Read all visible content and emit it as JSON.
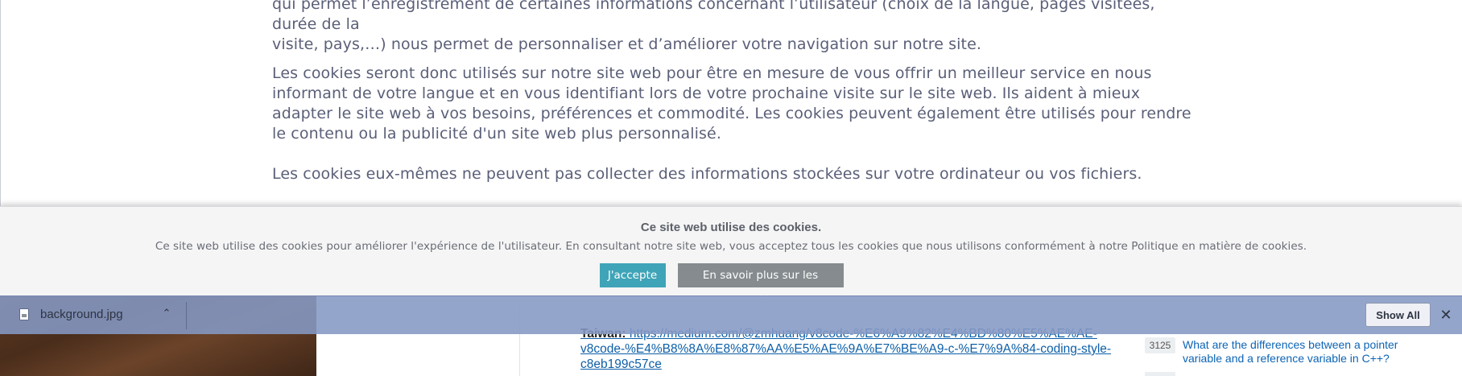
{
  "article": {
    "para1_line1": "qui permet l’enregistrement de certaines informations concernant l’utilisateur (choix de la langue, pages visitées, durée de la",
    "para1_line2": "visite, pays,…) nous permet de personnaliser et d’améliorer votre navigation sur notre site.",
    "para2": "Les cookies seront donc utilisés sur notre site web pour être en mesure de vous offrir un meilleur service en nous informant de votre langue et en vous identifiant lors de votre prochaine visite sur le site web. Ils aident à mieux adapter le site web à vos besoins, préférences et commodité. Les cookies peuvent également être utilisés pour rendre le contenu ou la publicité d'un site web plus personnalisé.",
    "para3": "Les cookies eux-mêmes ne peuvent pas collecter des informations stockées sur votre ordinateur ou vos fichiers."
  },
  "cookie_banner": {
    "title": "Ce site web utilise des cookies.",
    "text": "Ce site web utilise des cookies pour améliorer l'expérience de l'utilisateur. En consultant notre site web, vous acceptez tous les cookies que nous utilisons conformément à notre Politique en matière de cookies.",
    "accept_label": "J'accepte",
    "learn_more_label": "En savoir plus sur les cookies",
    "accept_color": "#3fa4b8",
    "learn_more_color": "#858b8e"
  },
  "download_bar": {
    "file_name": "background.jpg",
    "file_icon": "file-image-icon",
    "menu_icon": "chevron-up-icon",
    "show_all_label": "Show All",
    "close_icon": "close-icon"
  },
  "background_page": {
    "link_prefix": "Taiwan:",
    "link_text": "https://medium.com/@zmhuang/v8code-%E6%A9%82%E4%BD%80%E5%AE%AE-v8code-%E4%B8%8A%E8%87%AA%E5%AE%9A%E7%BE%A9-c-%E7%9A%84-coding-style-c8eb199c57ce",
    "question_score": "3125",
    "question_text": "What are the differences between a pointer variable and a reference variable in C++?"
  }
}
